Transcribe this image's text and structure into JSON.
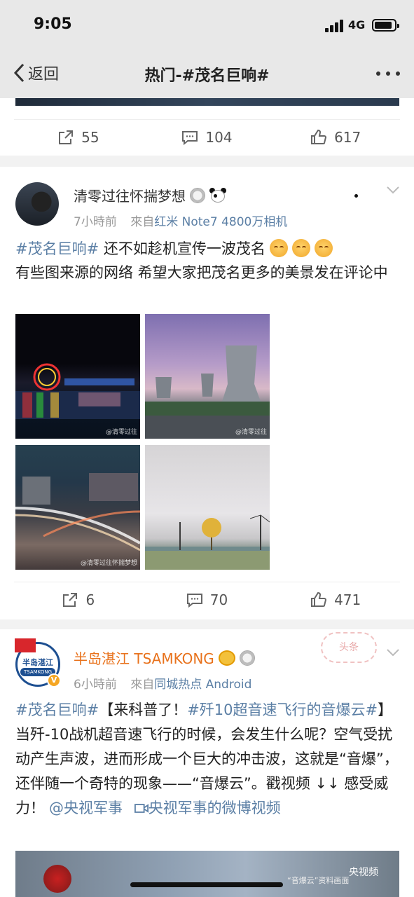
{
  "status": {
    "time": "9:05",
    "network": "4G"
  },
  "nav": {
    "back_label": "返回",
    "title": "热门-#茂名巨响#"
  },
  "post1": {
    "reposts": "55",
    "comments": "104",
    "likes": "617"
  },
  "post2": {
    "username": "清零过往怀揣梦想",
    "time": "7小時前",
    "from_label": "來自",
    "source": "红米 Note7 4800万相机",
    "hashtag": "#茂名巨响#",
    "text_1": " 还不如趁机宣传一波茂名",
    "text_2": "有些图来源的网络  希望大家把茂名更多的美景发在评论中",
    "photo_watermarks": [
      "@清零过往",
      "@清零过往",
      "@清零过往怀揣梦想",
      ""
    ],
    "reposts": "6",
    "comments": "70",
    "likes": "471"
  },
  "post3": {
    "username": "半岛湛江 TSAMKONG",
    "avatar_text": "半岛湛江",
    "avatar_sub": "TSAMKONG",
    "time": "6小時前",
    "from_label": "來自",
    "source": "同城热点 Android",
    "hashtag1": "#茂名巨响#",
    "text_a": "【来科普了！",
    "hashtag2": "#歼10超音速飞行的音爆云#",
    "text_b": "】当歼-10战机超音速飞行的时候，会发生什么呢？空气受扰动产生声波，进而形成一个巨大的冲击波，这就是“音爆”，还伴随一个奇特的现象——“音爆云”。戳视频 ↓↓ 感受威力！",
    "mention": "@央视军事",
    "video_link": "央视军事的微博视频",
    "stamp": "头条",
    "video_caption": "“音爆云”资料画面",
    "video_brand": "央视频"
  },
  "colors": {
    "link": "#5b7fa5",
    "vip_name": "#e8721c"
  }
}
